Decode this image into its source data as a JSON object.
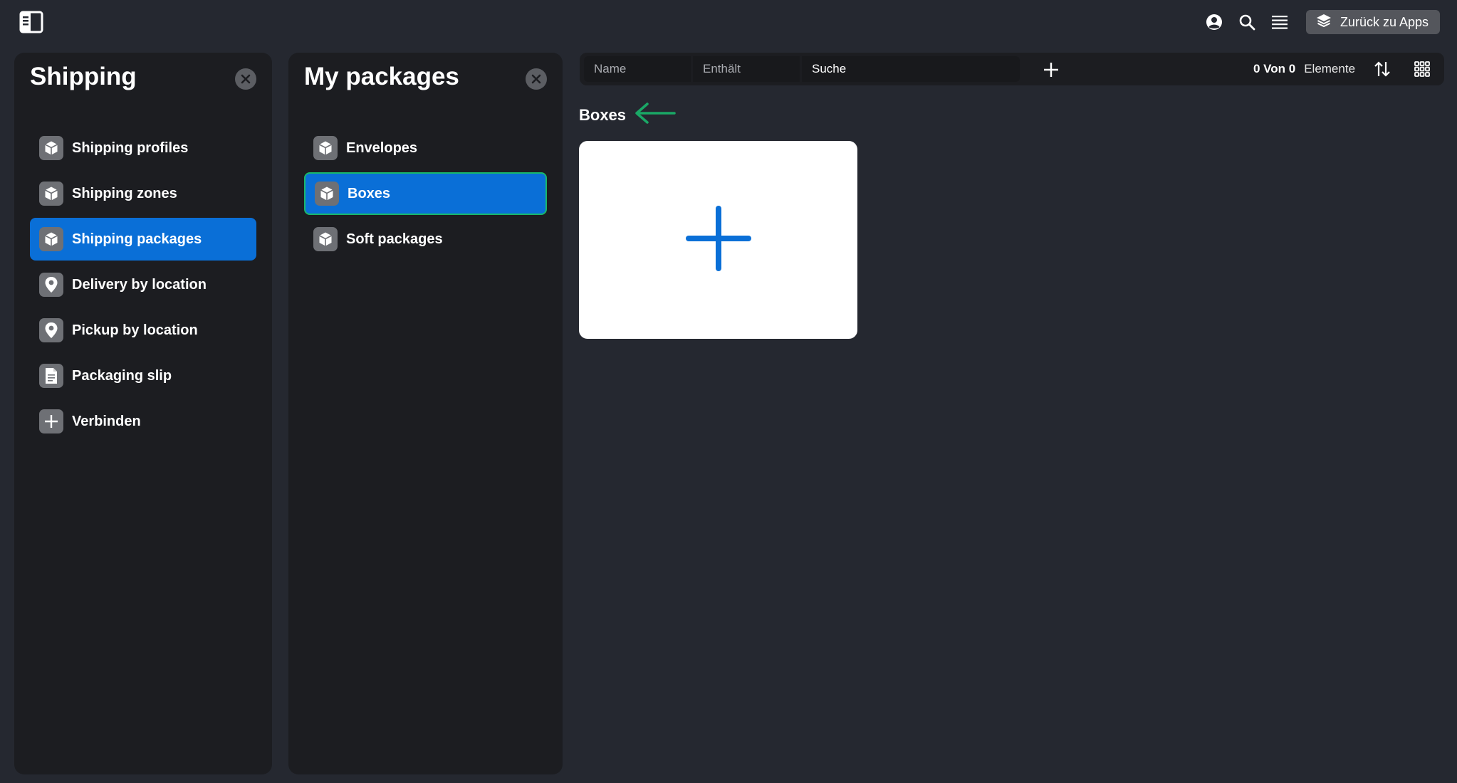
{
  "topbar": {
    "back_button_label": "Zurück zu Apps"
  },
  "shipping_panel": {
    "title": "Shipping",
    "items": [
      {
        "label": "Shipping profiles",
        "icon": "cube-icon"
      },
      {
        "label": "Shipping zones",
        "icon": "cube-icon"
      },
      {
        "label": "Shipping packages",
        "icon": "cube-icon",
        "active": true
      },
      {
        "label": "Delivery by location",
        "icon": "map-pin-icon"
      },
      {
        "label": "Pickup by location",
        "icon": "map-pin-icon"
      },
      {
        "label": "Packaging slip",
        "icon": "document-icon"
      },
      {
        "label": "Verbinden",
        "icon": "plus-icon"
      }
    ]
  },
  "packages_panel": {
    "title": "My packages",
    "items": [
      {
        "label": "Envelopes",
        "icon": "cube-icon"
      },
      {
        "label": "Boxes",
        "icon": "cube-icon",
        "active": true
      },
      {
        "label": "Soft packages",
        "icon": "cube-icon"
      }
    ]
  },
  "toolbar": {
    "filter_field": "Name",
    "filter_operator": "Enthält",
    "search_placeholder": "Suche",
    "count_text": "0 Von 0",
    "count_label": "Elemente"
  },
  "main": {
    "section_title": "Boxes"
  },
  "colors": {
    "background": "#252830",
    "panel": "#1c1d21",
    "accent": "#0a6fd7",
    "highlight_outline": "#19b86b",
    "arrow": "#1aa866"
  }
}
